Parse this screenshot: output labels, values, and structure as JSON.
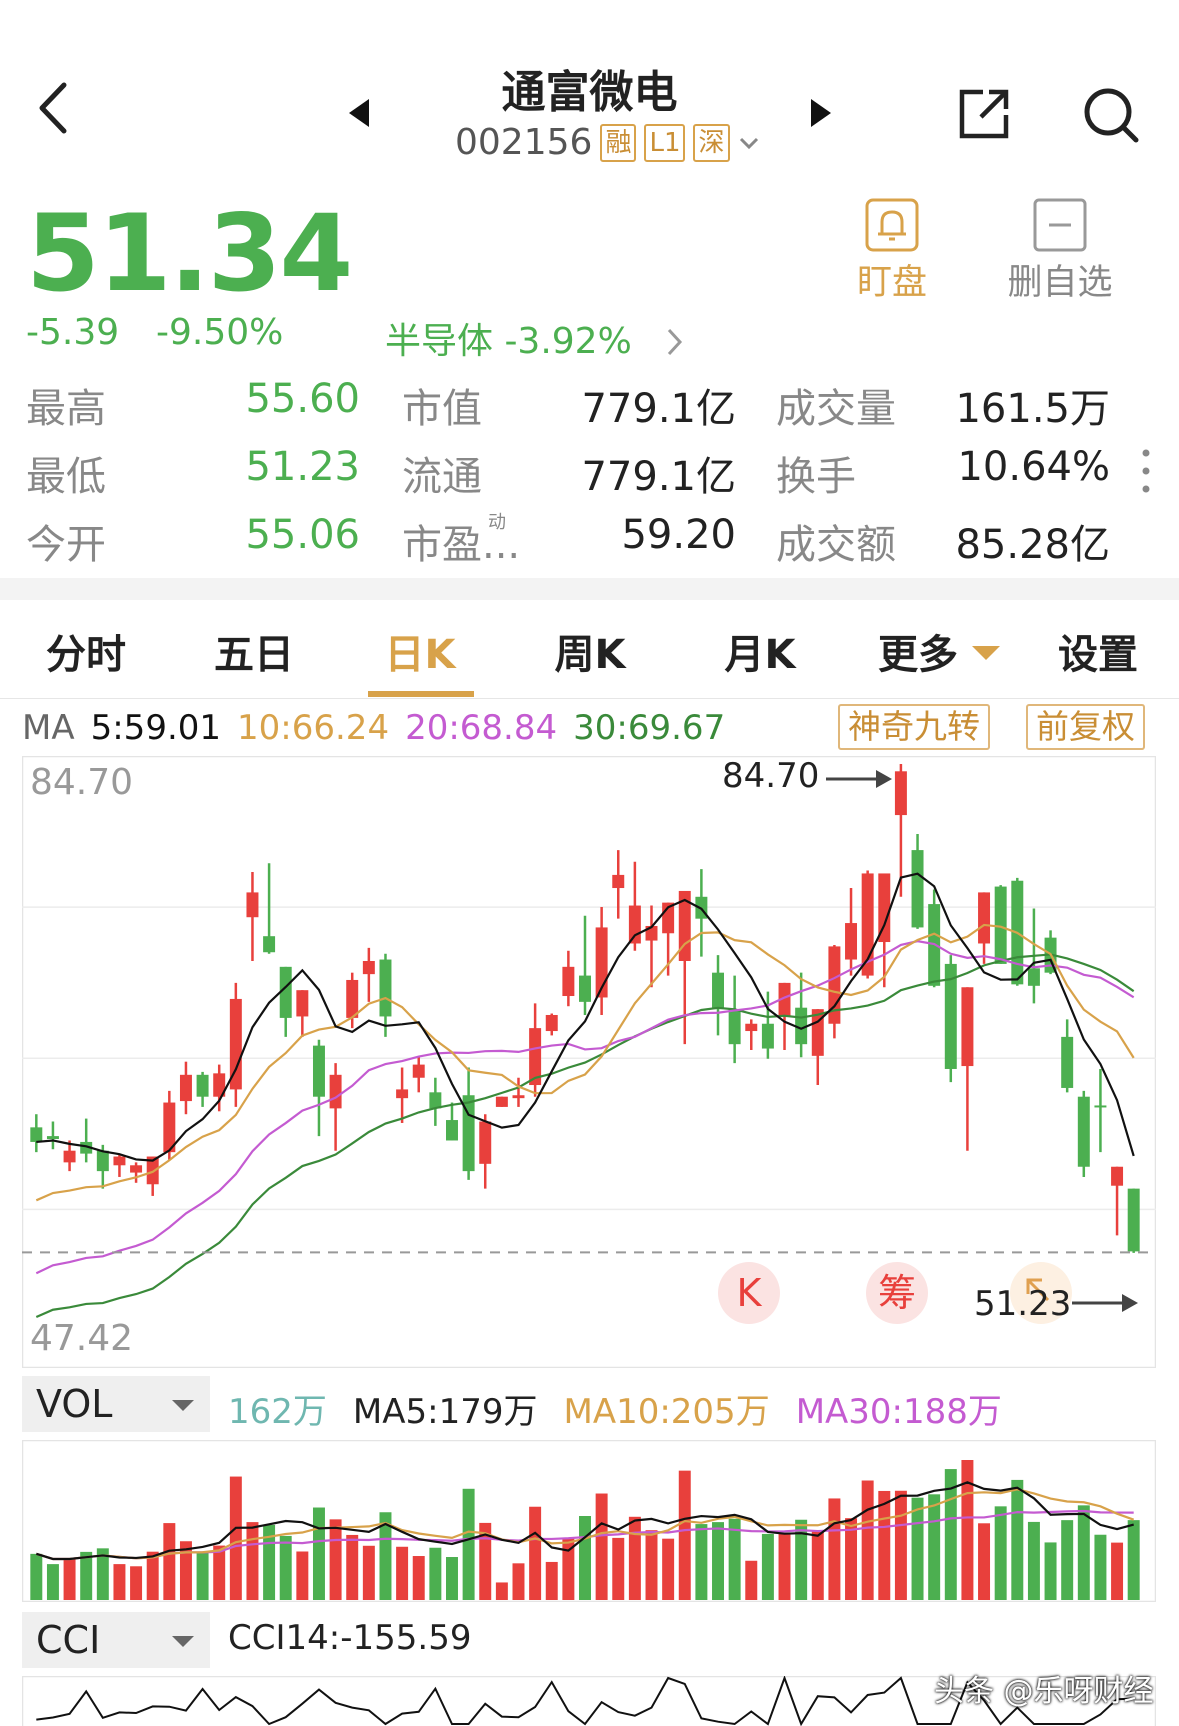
{
  "header": {
    "title": "通富微电",
    "code": "002156",
    "tags": [
      "融",
      "L1",
      "深"
    ]
  },
  "quote": {
    "price": "51.34",
    "change": "-5.39",
    "change_pct": "-9.50%",
    "sector": "半导体 -3.92%",
    "actions": {
      "watch": "盯盘",
      "remove": "删自选"
    }
  },
  "stats": {
    "rows": [
      [
        {
          "label": "最高",
          "value": "55.60"
        },
        {
          "label": "市值",
          "value": "779.1亿"
        },
        {
          "label": "成交量",
          "value": "161.5万"
        }
      ],
      [
        {
          "label": "最低",
          "value": "51.23"
        },
        {
          "label": "流通",
          "value": "779.1亿"
        },
        {
          "label": "换手",
          "value": "10.64%"
        }
      ],
      [
        {
          "label": "今开",
          "value": "55.06"
        },
        {
          "label": "市盈...",
          "value": "59.20"
        },
        {
          "label": "成交额",
          "value": "85.28亿"
        }
      ]
    ],
    "pe_sup": "动"
  },
  "tabs": [
    "分时",
    "五日",
    "日K",
    "周K",
    "月K",
    "更多",
    "设置"
  ],
  "active_tab": "日K",
  "ma": {
    "label": "MA",
    "ma5": "5:59.01",
    "ma10": "10:66.24",
    "ma20": "20:68.84",
    "ma30": "30:69.67",
    "btn_nine": "神奇九转",
    "btn_adjust": "前复权"
  },
  "chart_annot": {
    "top_left": "84.70",
    "bottom_left": "47.42",
    "high_label": "84.70",
    "low_label": "51.23",
    "k_badge": "K",
    "chip_badge": "筹"
  },
  "vol": {
    "selector": "VOL",
    "current": "162万",
    "ma5": "MA5:179万",
    "ma10": "MA10:205万",
    "ma30": "MA30:188万"
  },
  "cci": {
    "selector": "CCI",
    "value": "CCI14:-155.59"
  },
  "watermark": "头条 @乐呀财经",
  "colors": {
    "up": "#e8403c",
    "down": "#4caf50",
    "accent": "#d8a24a",
    "ma5": "#111111",
    "ma10": "#d8a24a",
    "ma20": "#c45bd1",
    "ma30": "#3a8a3a"
  },
  "chart_data": {
    "type": "candlestick",
    "ylim": [
      47.42,
      84.7
    ],
    "candles": [
      {
        "o": 59.8,
        "h": 60.7,
        "l": 58.1,
        "c": 58.8
      },
      {
        "o": 59.2,
        "h": 60.2,
        "l": 58.3,
        "c": 59.0
      },
      {
        "o": 57.4,
        "h": 58.9,
        "l": 56.8,
        "c": 58.2
      },
      {
        "o": 58.8,
        "h": 60.4,
        "l": 57.4,
        "c": 58.0
      },
      {
        "o": 58.2,
        "h": 58.6,
        "l": 55.6,
        "c": 56.8
      },
      {
        "o": 57.2,
        "h": 58.0,
        "l": 56.4,
        "c": 57.8
      },
      {
        "o": 56.7,
        "h": 57.4,
        "l": 56.0,
        "c": 57.2
      },
      {
        "o": 55.9,
        "h": 57.3,
        "l": 55.1,
        "c": 57.8
      },
      {
        "o": 58.1,
        "h": 62.3,
        "l": 57.6,
        "c": 61.5
      },
      {
        "o": 61.6,
        "h": 64.3,
        "l": 60.7,
        "c": 63.4
      },
      {
        "o": 63.4,
        "h": 63.6,
        "l": 61.2,
        "c": 61.9
      },
      {
        "o": 61.9,
        "h": 64.1,
        "l": 60.9,
        "c": 63.5
      },
      {
        "o": 62.4,
        "h": 69.7,
        "l": 61.2,
        "c": 68.6
      },
      {
        "o": 74.2,
        "h": 77.3,
        "l": 71.2,
        "c": 75.9
      },
      {
        "o": 72.9,
        "h": 77.9,
        "l": 71.7,
        "c": 71.8
      },
      {
        "o": 70.8,
        "h": 69.0,
        "l": 66.0,
        "c": 67.3
      },
      {
        "o": 67.4,
        "h": 68.3,
        "l": 66.0,
        "c": 69.2
      },
      {
        "o": 65.4,
        "h": 65.8,
        "l": 59.2,
        "c": 61.9
      },
      {
        "o": 61.1,
        "h": 64.2,
        "l": 58.2,
        "c": 63.4
      },
      {
        "o": 67.3,
        "h": 70.4,
        "l": 66.6,
        "c": 69.9
      },
      {
        "o": 70.3,
        "h": 72.1,
        "l": 68.4,
        "c": 71.2
      },
      {
        "o": 71.3,
        "h": 71.7,
        "l": 66.0,
        "c": 67.4
      },
      {
        "o": 61.8,
        "h": 63.9,
        "l": 60.1,
        "c": 62.4
      },
      {
        "o": 63.2,
        "h": 64.6,
        "l": 62.2,
        "c": 64.1
      },
      {
        "o": 62.2,
        "h": 63.2,
        "l": 59.9,
        "c": 61.1
      },
      {
        "o": 60.3,
        "h": 61.5,
        "l": 59.6,
        "c": 58.9
      },
      {
        "o": 62.0,
        "h": 63.9,
        "l": 56.2,
        "c": 56.8
      },
      {
        "o": 57.3,
        "h": 60.7,
        "l": 55.6,
        "c": 60.2
      },
      {
        "o": 61.2,
        "h": 61.6,
        "l": 62.4,
        "c": 61.9
      },
      {
        "o": 61.8,
        "h": 63.2,
        "l": 61.2,
        "c": 62.0
      },
      {
        "o": 62.7,
        "h": 68.3,
        "l": 61.9,
        "c": 66.6
      },
      {
        "o": 66.4,
        "h": 67.6,
        "l": 66.1,
        "c": 67.5
      },
      {
        "o": 68.8,
        "h": 71.9,
        "l": 68.1,
        "c": 70.8
      },
      {
        "o": 70.2,
        "h": 74.3,
        "l": 67.5,
        "c": 68.4
      },
      {
        "o": 68.7,
        "h": 74.9,
        "l": 67.5,
        "c": 73.5
      },
      {
        "o": 76.2,
        "h": 78.8,
        "l": 74.1,
        "c": 77.1
      },
      {
        "o": 72.4,
        "h": 78.0,
        "l": 71.9,
        "c": 75.0
      },
      {
        "o": 72.6,
        "h": 75.0,
        "l": 69.4,
        "c": 73.6
      },
      {
        "o": 73.1,
        "h": 73.9,
        "l": 70.2,
        "c": 75.2
      },
      {
        "o": 71.2,
        "h": 75.8,
        "l": 65.5,
        "c": 76.0
      },
      {
        "o": 75.6,
        "h": 77.5,
        "l": 71.5,
        "c": 74.1
      },
      {
        "o": 70.4,
        "h": 71.6,
        "l": 66.1,
        "c": 67.9
      },
      {
        "o": 67.9,
        "h": 70.2,
        "l": 64.2,
        "c": 65.5
      },
      {
        "o": 66.4,
        "h": 67.2,
        "l": 65.1,
        "c": 66.9
      },
      {
        "o": 66.9,
        "h": 69.1,
        "l": 64.5,
        "c": 65.2
      },
      {
        "o": 67.4,
        "h": 69.4,
        "l": 65.1,
        "c": 69.7
      },
      {
        "o": 68.0,
        "h": 70.4,
        "l": 64.6,
        "c": 65.5
      },
      {
        "o": 64.7,
        "h": 66.5,
        "l": 62.7,
        "c": 67.9
      },
      {
        "o": 66.9,
        "h": 72.3,
        "l": 65.9,
        "c": 72.2
      },
      {
        "o": 71.3,
        "h": 76.2,
        "l": 70.2,
        "c": 73.8
      },
      {
        "o": 70.2,
        "h": 77.4,
        "l": 70.0,
        "c": 77.2
      },
      {
        "o": 72.5,
        "h": 77.2,
        "l": 69.4,
        "c": 77.2
      },
      {
        "o": 81.2,
        "h": 84.7,
        "l": 75.6,
        "c": 84.2
      },
      {
        "o": 78.8,
        "h": 79.9,
        "l": 73.4,
        "c": 73.5
      },
      {
        "o": 75.1,
        "h": 76.1,
        "l": 69.4,
        "c": 69.5
      },
      {
        "o": 71.0,
        "h": 71.6,
        "l": 62.9,
        "c": 63.8
      },
      {
        "o": 64.0,
        "h": 69.4,
        "l": 58.2,
        "c": 69.4
      },
      {
        "o": 72.4,
        "h": 75.6,
        "l": 71.0,
        "c": 75.9
      },
      {
        "o": 76.3,
        "h": 76.4,
        "l": 71.0,
        "c": 71.0
      },
      {
        "o": 76.7,
        "h": 76.9,
        "l": 69.5,
        "c": 69.6
      },
      {
        "o": 70.7,
        "h": 74.8,
        "l": 68.3,
        "c": 69.5
      },
      {
        "o": 72.8,
        "h": 73.3,
        "l": 70.3,
        "c": 70.4
      },
      {
        "o": 66.0,
        "h": 67.2,
        "l": 62.2,
        "c": 62.5
      },
      {
        "o": 61.9,
        "h": 62.3,
        "l": 56.4,
        "c": 57.1
      },
      {
        "o": 61.3,
        "h": 63.8,
        "l": 58.1,
        "c": 61.2
      },
      {
        "o": 55.8,
        "h": 56.2,
        "l": 52.4,
        "c": 57.1
      },
      {
        "o": 55.6,
        "h": 55.6,
        "l": 51.2,
        "c": 51.3
      }
    ],
    "volume": {
      "ma5": "179万",
      "ma10": "205万",
      "ma30": "188万",
      "current": "162万"
    }
  }
}
